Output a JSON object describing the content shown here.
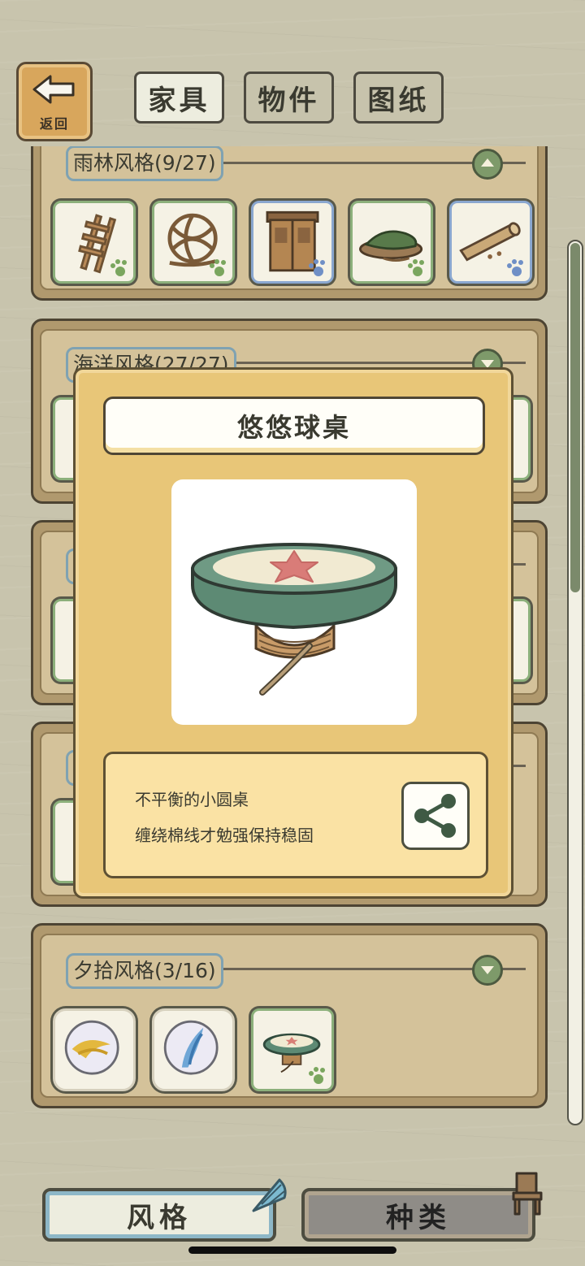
{
  "header": {
    "back_label": "返回",
    "tabs": [
      {
        "label": "家具",
        "active": true
      },
      {
        "label": "物件",
        "active": false
      },
      {
        "label": "图纸",
        "active": false
      }
    ]
  },
  "sections": [
    {
      "title": "雨林风格(9/27)",
      "expanded": true,
      "items": [
        "ladder",
        "vine-ball",
        "wooden-door",
        "leaf-bed",
        "log"
      ]
    },
    {
      "title": "海洋风格(27/27)",
      "expanded": false
    },
    {
      "title": "",
      "expanded": false
    },
    {
      "title": "",
      "expanded": false
    },
    {
      "title": "夕拾风格(3/16)",
      "expanded": false,
      "items": [
        "marble-yellow",
        "marble-blue",
        "youyou-table"
      ]
    }
  ],
  "modal": {
    "title": "悠悠球桌",
    "description_line1": "不平衡的小圆桌",
    "description_line2": "缠绕棉线才勉强保持稳固",
    "share_icon": "share-icon"
  },
  "bottom_tabs": [
    {
      "label": "风格",
      "active": true,
      "icon": "seashell-icon"
    },
    {
      "label": "种类",
      "active": false,
      "icon": "chair-icon"
    }
  ],
  "colors": {
    "background": "#c8c4ad",
    "panel": "#b0996e",
    "modal": "#e8c678",
    "accent_green": "#7e9a6a",
    "accent_blue": "#8aa7cf"
  }
}
